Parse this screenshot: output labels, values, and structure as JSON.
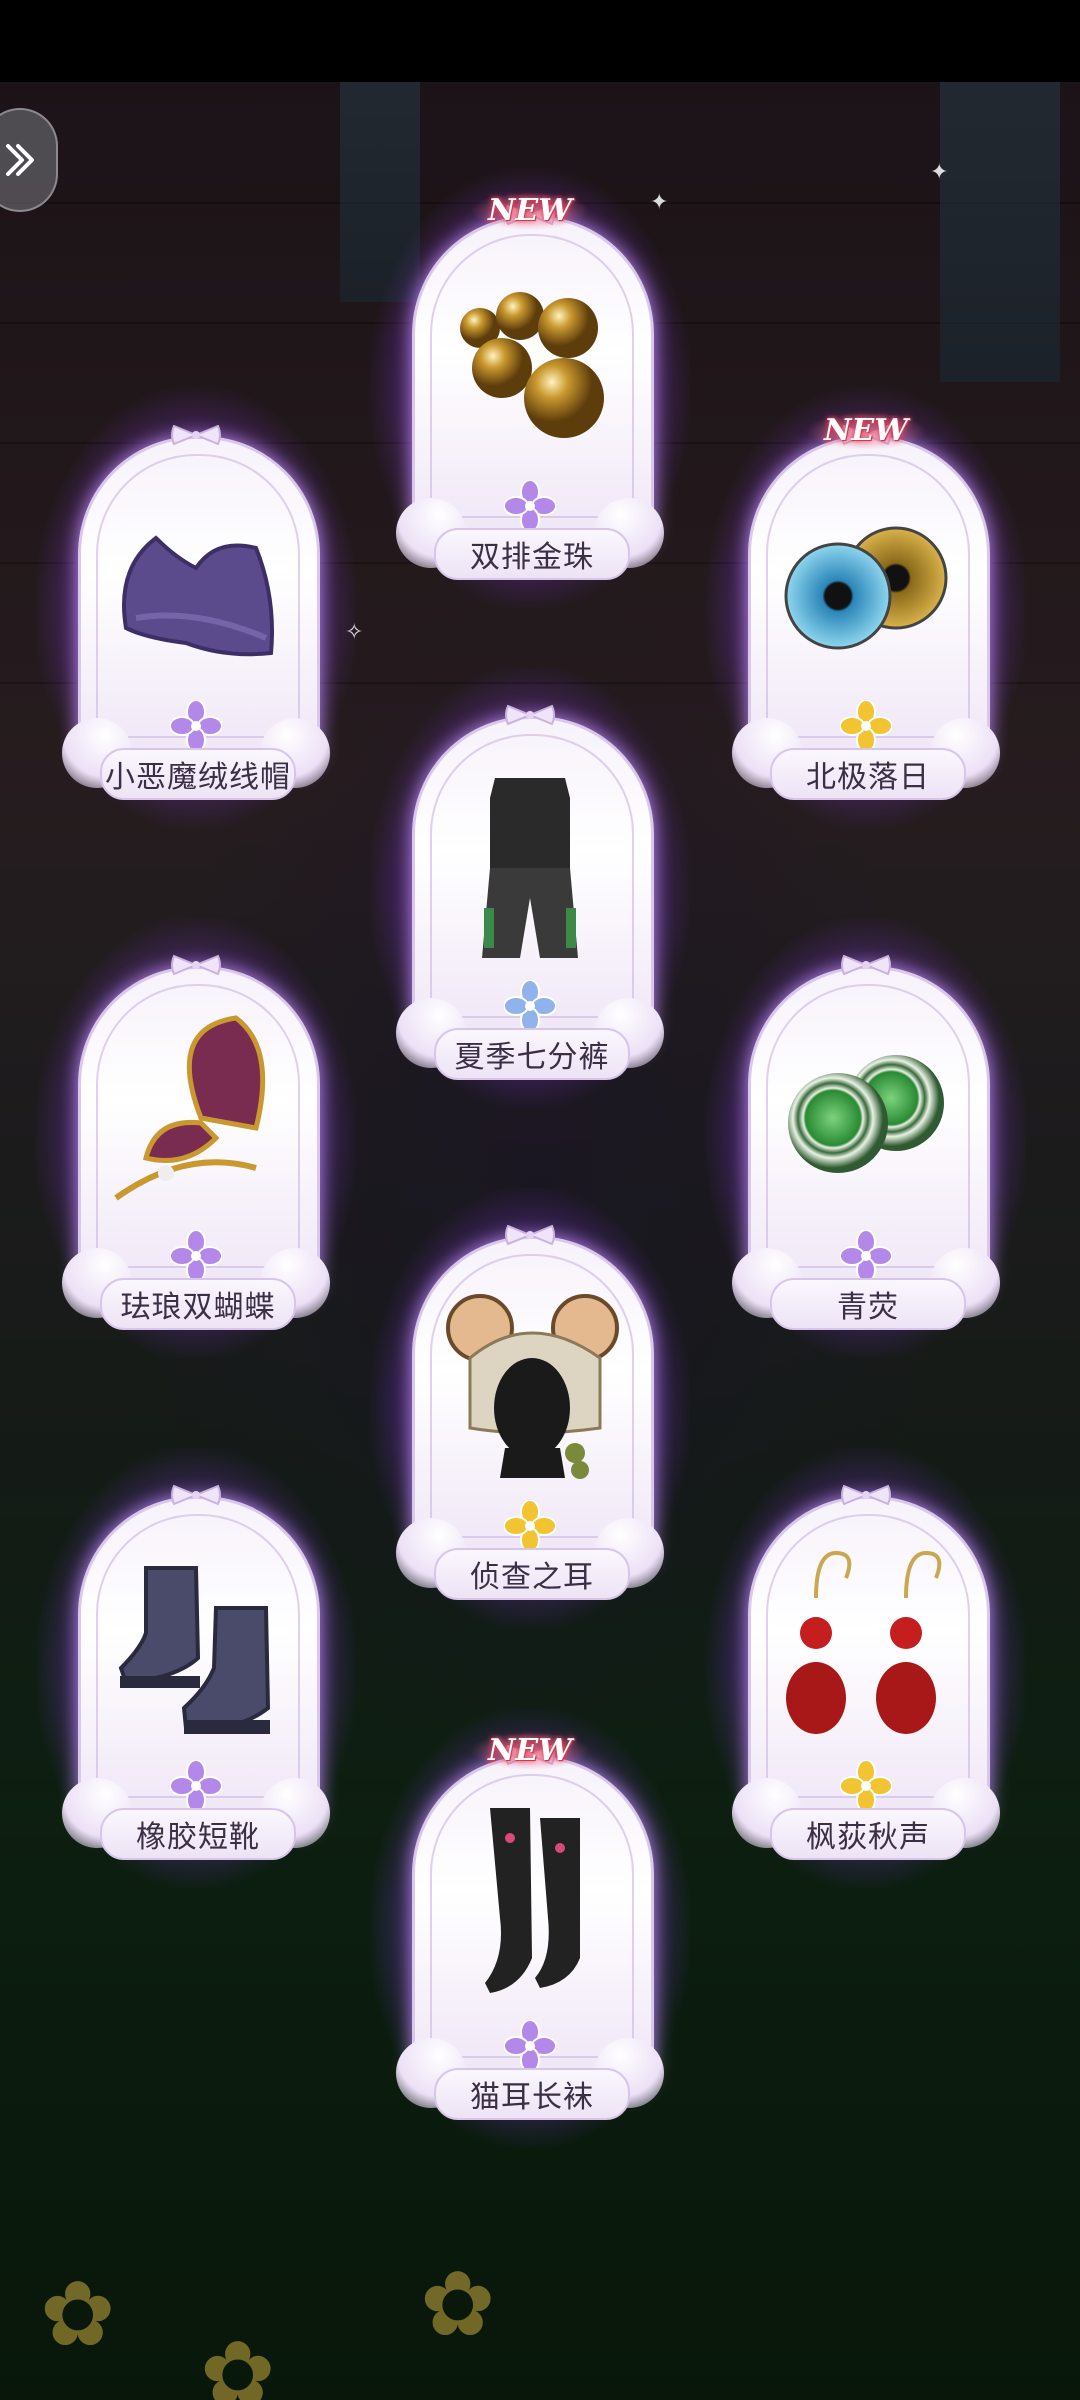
{
  "screen": {
    "title": ""
  },
  "back_button": {
    "icon": "double-chevron-right-icon"
  },
  "colors": {
    "glow": "#a04cff",
    "card_bg": "#f7f2fb",
    "name_text": "#3b2f45",
    "new_badge": "#e0455d",
    "rarity_purple": "#b488e8",
    "rarity_gold": "#f2c431",
    "rarity_blue": "#8fb3ea"
  },
  "items": [
    {
      "name": "双排金珠",
      "new": "NEW",
      "rarity": "purple",
      "icon": "gold-beads-icon"
    },
    {
      "name": "小恶魔绒线帽",
      "new": "",
      "rarity": "purple",
      "icon": "knit-hat-icon"
    },
    {
      "name": "北极落日",
      "new": "NEW",
      "rarity": "gold",
      "icon": "eye-lenses-icon"
    },
    {
      "name": "夏季七分裤",
      "new": "",
      "rarity": "blue",
      "icon": "outfit-icon"
    },
    {
      "name": "珐琅双蝴蝶",
      "new": "",
      "rarity": "purple",
      "icon": "butterfly-hairpin-icon"
    },
    {
      "name": "青荧",
      "new": "",
      "rarity": "purple",
      "icon": "green-eyes-icon"
    },
    {
      "name": "侦查之耳",
      "new": "",
      "rarity": "gold",
      "icon": "ear-hat-icon"
    },
    {
      "name": "橡胶短靴",
      "new": "",
      "rarity": "purple",
      "icon": "boots-icon"
    },
    {
      "name": "枫荻秋声",
      "new": "",
      "rarity": "gold",
      "icon": "earrings-icon"
    },
    {
      "name": "猫耳长袜",
      "new": "NEW",
      "rarity": "purple",
      "icon": "stockings-icon"
    }
  ]
}
